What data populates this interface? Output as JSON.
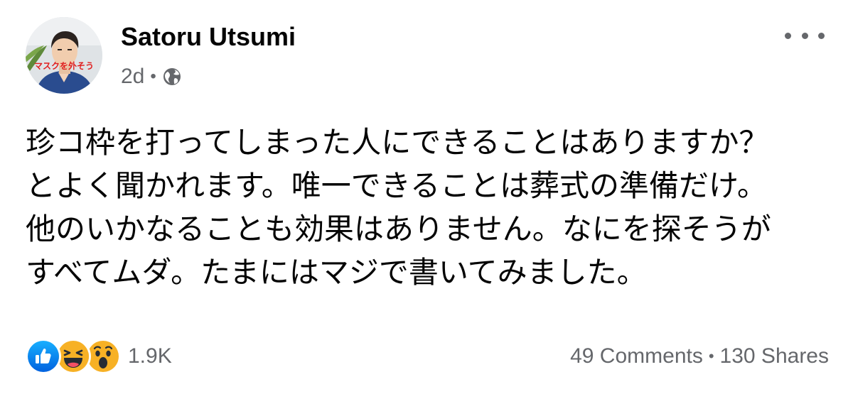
{
  "author": {
    "name": "Satoru Utsumi",
    "avatar_caption": "マスクを外そう"
  },
  "meta": {
    "time": "2d",
    "separator": "•",
    "audience_icon": "globe-icon"
  },
  "post": {
    "lines": [
      "珍コ枠を打ってしまった人にできることはありますか？",
      "とよく聞かれます。唯一できることは葬式の準備だけ。",
      "他のいかなることも効果はありません。なにを探そうが",
      "すべてムダ。たまにはマジで書いてみました。"
    ]
  },
  "reactions": {
    "icons": [
      "like-icon",
      "haha-icon",
      "wow-icon"
    ],
    "count": "1.9K"
  },
  "engagement": {
    "comments": "49 Comments",
    "separator": "•",
    "shares": "130 Shares"
  },
  "colors": {
    "text_primary": "#050505",
    "text_secondary": "#65676b",
    "like_blue": "#1877f2",
    "emoji_yellow": "#f7b125"
  }
}
